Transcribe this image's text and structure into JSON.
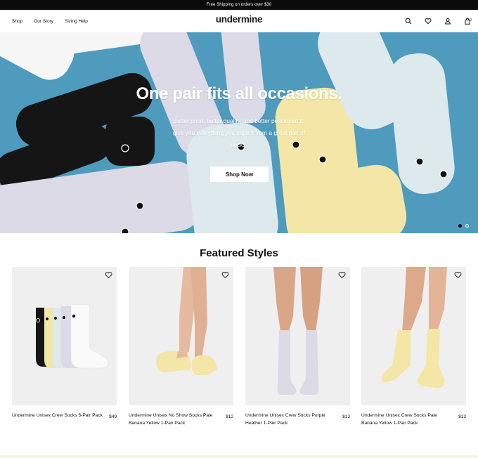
{
  "announcement": "Free Shipping on orders over $30",
  "header": {
    "logo": "undermine",
    "nav": [
      "Shop",
      "Our Story",
      "Sizing Help"
    ],
    "cart_count": "0",
    "icons": [
      "search-icon",
      "heart-icon",
      "user-icon",
      "bag-icon"
    ]
  },
  "hero": {
    "title": "One pair fits all occasions.",
    "subtitle": "Better price, better quality, and better positioned to give you everything you expect from a great pair of socks.",
    "button": "Shop Now",
    "background_color": "#4e9bbd",
    "slide_count": 2,
    "active_slide": 1
  },
  "featured": {
    "title": "Featured Styles",
    "products": [
      {
        "name": "Undermine Unisex Crew Socks 5-Pair Pack",
        "price": "$49"
      },
      {
        "name": "Undermine Unisex No Show Socks Pale Banana Yellow 1-Pair Pack",
        "price": "$12"
      },
      {
        "name": "Undermine Unisex Crew Socks Purple Heather 1-Pair Pack",
        "price": "$13"
      },
      {
        "name": "Undermine Unisex Crew Socks Pale Banana Yellow 1-Pair Pack",
        "price": "$13"
      }
    ]
  },
  "colors": {
    "sock_yellow": "#f3e6a6",
    "sock_purple": "#dcdae6",
    "sock_mint": "#dde9ec",
    "sock_black": "#151515"
  }
}
